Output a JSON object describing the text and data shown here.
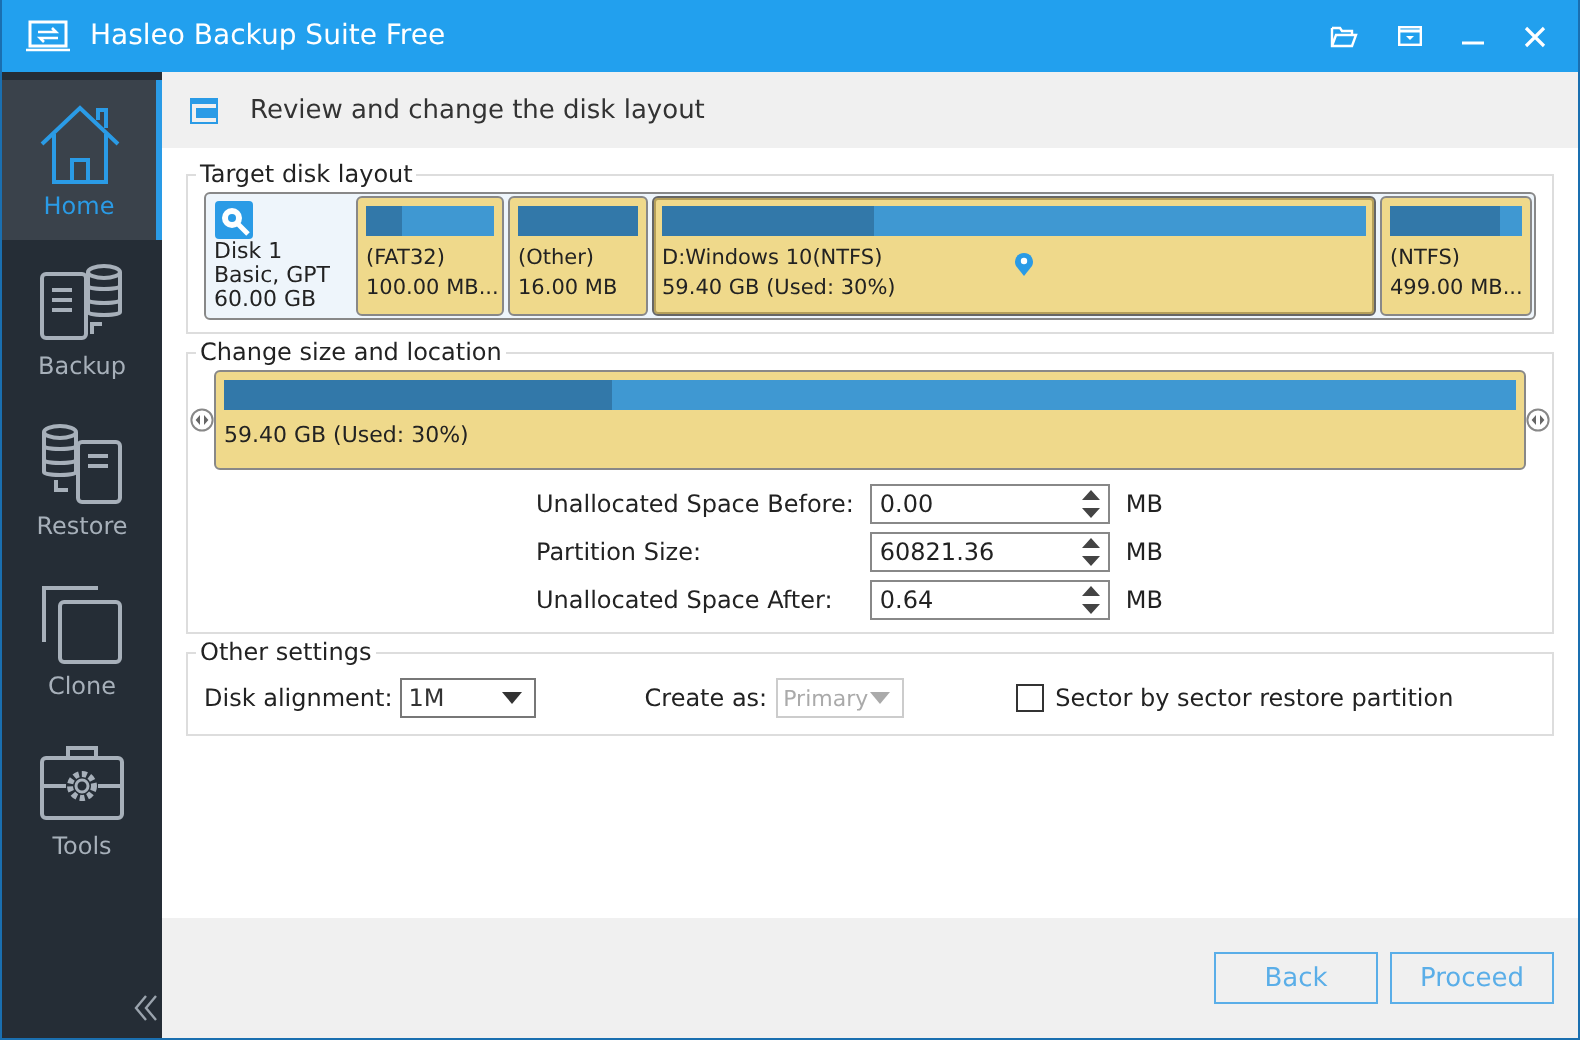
{
  "window": {
    "title": "Hasleo Backup Suite Free"
  },
  "sidebar": {
    "items": [
      {
        "label": "Home",
        "kind": "home",
        "selected": true
      },
      {
        "label": "Backup",
        "kind": "backup",
        "selected": false
      },
      {
        "label": "Restore",
        "kind": "restore",
        "selected": false
      },
      {
        "label": "Clone",
        "kind": "clone",
        "selected": false
      },
      {
        "label": "Tools",
        "kind": "tools",
        "selected": false
      }
    ]
  },
  "header": {
    "title": "Review and change the disk layout"
  },
  "target_disk_layout": {
    "title": "Target disk layout",
    "disk": {
      "name": "Disk 1",
      "type": "Basic, GPT",
      "size": "60.00 GB"
    },
    "partitions": [
      {
        "label": "(FAT32)",
        "size": "100.00 MB...",
        "level": 0.28,
        "selected": false
      },
      {
        "label": "(Other)",
        "size": "16.00 MB",
        "level": 1.0,
        "selected": false
      },
      {
        "label": "D:Windows 10(NTFS)",
        "size": "59.40 GB (Used: 30%)",
        "level": 0.3,
        "selected": true
      },
      {
        "label": "(NTFS)",
        "size": "499.00 MB...",
        "level": 0.84,
        "selected": false
      }
    ]
  },
  "change_size": {
    "title": "Change size and location",
    "partition": {
      "size": "59.40 GB (Used: 30%)",
      "level": 0.3
    },
    "fields": [
      {
        "label": "Unallocated Space Before:",
        "value": "0.00",
        "unit": "MB"
      },
      {
        "label": "Partition Size:",
        "value": "60821.36",
        "unit": "MB"
      },
      {
        "label": "Unallocated Space After:",
        "value": "0.64",
        "unit": "MB"
      }
    ]
  },
  "other_settings": {
    "title": "Other settings",
    "disk_alignment": {
      "label": "Disk alignment:",
      "value": "1M",
      "disabled": false
    },
    "create_as": {
      "label": "Create as:",
      "value": "Primary",
      "disabled": true
    },
    "sector_by_sector": {
      "label": "Sector by sector restore partition",
      "checked": false
    }
  },
  "buttons": [
    {
      "label": "Back"
    },
    {
      "label": "Proceed"
    }
  ]
}
